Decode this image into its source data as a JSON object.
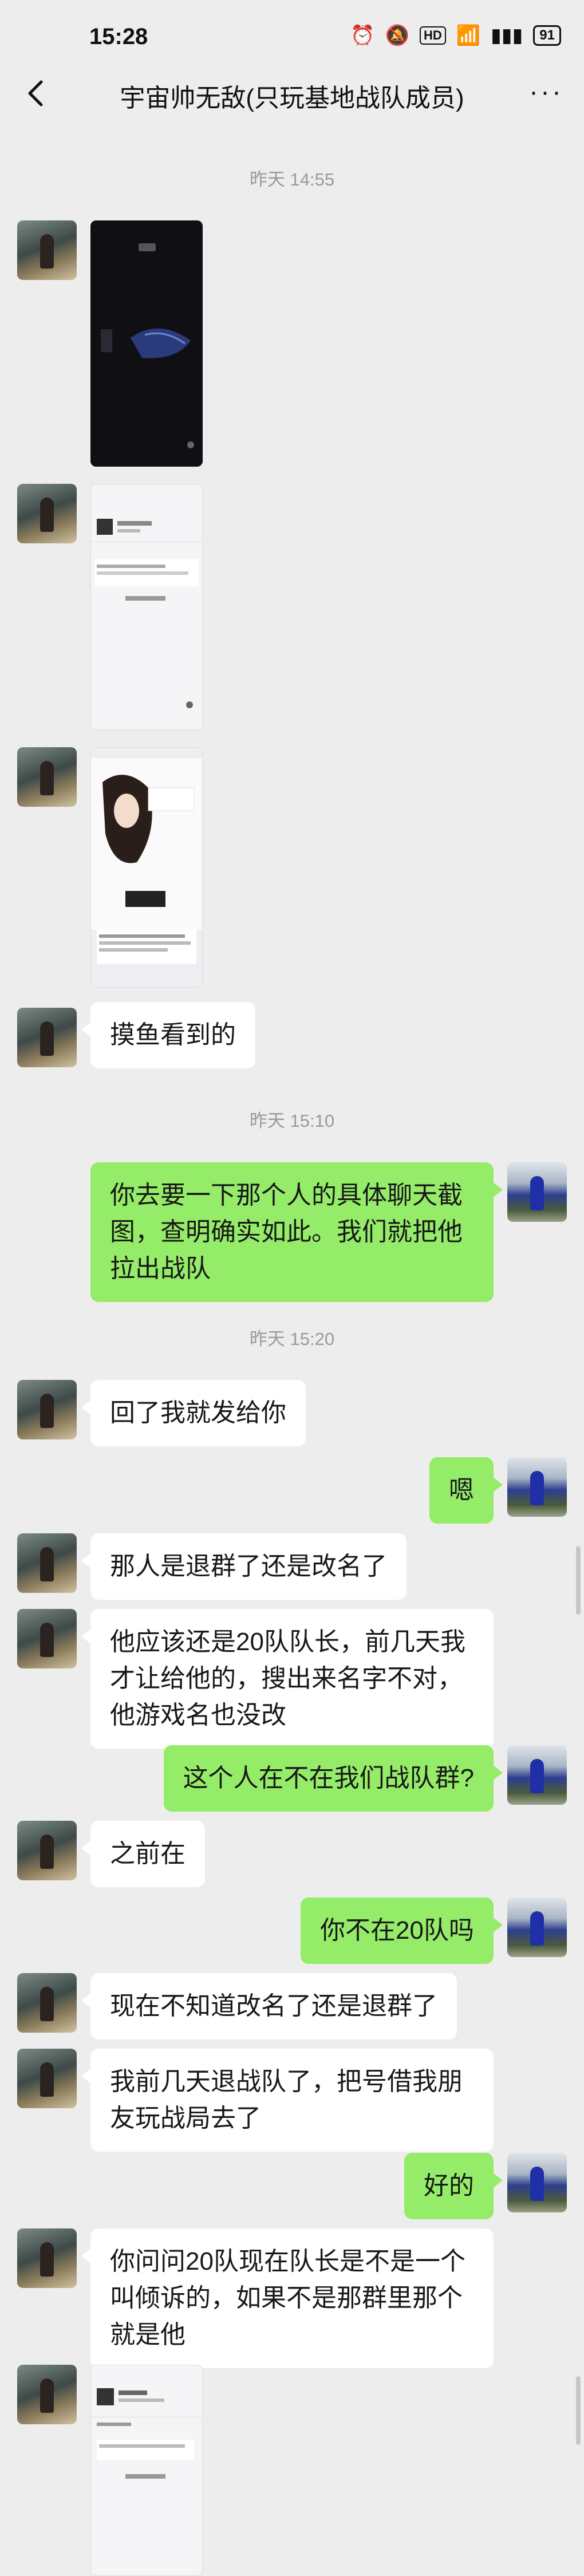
{
  "status_bar": {
    "time": "15:28",
    "battery": "91",
    "hd_label": "HD"
  },
  "nav": {
    "title": "宇宙帅无敌(只玩基地战队成员)"
  },
  "timestamps": [
    "昨天 14:55",
    "昨天 15:10",
    "昨天 15:20"
  ],
  "messages": [
    {
      "side": "left",
      "type": "image",
      "description_icon": "image-thumbnail"
    },
    {
      "side": "left",
      "type": "image",
      "description_icon": "image-thumbnail"
    },
    {
      "side": "left",
      "type": "image",
      "description_icon": "image-thumbnail"
    },
    {
      "side": "left",
      "type": "text",
      "text": "摸鱼看到的"
    },
    {
      "side": "right",
      "type": "text",
      "text": "你去要一下那个人的具体聊天截图，查明确实如此。我们就把他拉出战队"
    },
    {
      "side": "left",
      "type": "text",
      "text": "回了我就发给你"
    },
    {
      "side": "right",
      "type": "text",
      "text": "嗯"
    },
    {
      "side": "left",
      "type": "text",
      "text": "那人是退群了还是改名了"
    },
    {
      "side": "left",
      "type": "text",
      "text": "他应该还是20队队长，前几天我才让给他的，搜出来名字不对，他游戏名也没改"
    },
    {
      "side": "right",
      "type": "text",
      "text": "这个人在不在我们战队群?"
    },
    {
      "side": "left",
      "type": "text",
      "text": "之前在"
    },
    {
      "side": "right",
      "type": "text",
      "text": "你不在20队吗"
    },
    {
      "side": "left",
      "type": "text",
      "text": "现在不知道改名了还是退群了"
    },
    {
      "side": "left",
      "type": "text",
      "text": "我前几天退战队了，把号借我朋友玩战局去了"
    },
    {
      "side": "right",
      "type": "text",
      "text": "好的"
    },
    {
      "side": "left",
      "type": "text",
      "text": "你问问20队现在队长是不是一个叫倾诉的，如果不是那群里那个就是他"
    },
    {
      "side": "left",
      "type": "image",
      "description_icon": "image-thumbnail"
    }
  ]
}
